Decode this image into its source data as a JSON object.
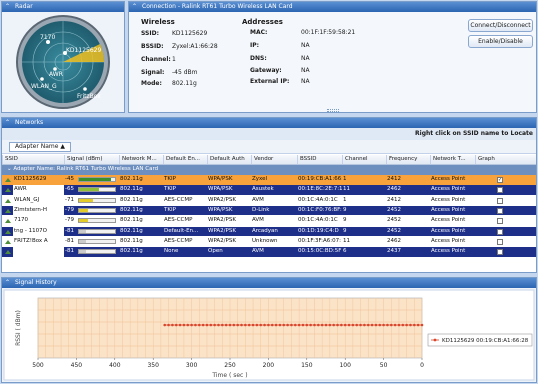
{
  "radar": {
    "title": "Radar",
    "labels": [
      "7170",
      "KD1125629",
      "AWR",
      "WLAN_G",
      "FritzBox"
    ]
  },
  "connection": {
    "title": "Connection - Ralink RT61 Turbo Wireless LAN Card",
    "wireless": {
      "heading": "Wireless",
      "ssid_label": "SSID:",
      "ssid": "KD1125629",
      "bssid_label": "BSSID:",
      "bssid": "Zyxel:A1:66:28",
      "channel_label": "Channel:",
      "channel": "1",
      "signal_label": "Signal:",
      "signal": "-45 dBm",
      "mode_label": "Mode:",
      "mode": "802.11g"
    },
    "addresses": {
      "heading": "Addresses",
      "mac_label": "MAC:",
      "mac": "00:1F:1F:59:58:21",
      "ip_label": "IP:",
      "ip": "NA",
      "dns_label": "DNS:",
      "dns": "NA",
      "gateway_label": "Gateway:",
      "gateway": "NA",
      "external_ip_label": "External IP:",
      "external_ip": "NA"
    },
    "buttons": {
      "connect": "Connect/Disconnect",
      "enable": "Enable/Disable"
    }
  },
  "networks": {
    "title": "Networks",
    "hint": "Right click on SSID name to Locate",
    "group_chip": "Adapter Name ▲",
    "group_row": "Adapter Name: Ralink RT61 Turbo Wireless LAN Card",
    "columns": [
      "SSID",
      "Signal (dBm)",
      "Network M...",
      "Default En...",
      "Default Auth",
      "Vendor",
      "BSSID",
      "Channel",
      "Frequency",
      "Network T...",
      "Graph"
    ],
    "rows": [
      {
        "ssid": "KD1125629",
        "signal": "-45",
        "mode": "802.11g",
        "enc": "TKIP",
        "auth": "WPA/PSK",
        "vendor": "Zyxel",
        "bssid": "00:19:CB:A1:66:28",
        "channel": "1",
        "freq": "2412",
        "type": "Access Point",
        "graph": "✓",
        "level": 0.88,
        "bar": "#3a8f2a",
        "style": "selected"
      },
      {
        "ssid": "AWR",
        "signal": "-65",
        "mode": "802.11g",
        "enc": "TKIP",
        "auth": "WPA/PSK",
        "vendor": "Asustek",
        "bssid": "00:1E:8C:2E:7:11",
        "channel": "11",
        "freq": "2462",
        "type": "Access Point",
        "graph": "",
        "level": 0.55,
        "bar": "#8fbf3a",
        "style": "dark"
      },
      {
        "ssid": "WLAN_GJ",
        "signal": "-71",
        "mode": "802.11g",
        "enc": "AES-CCMP",
        "auth": "WPA2/PSK",
        "vendor": "AVM",
        "bssid": "00:1C:4A:0:1C",
        "channel": "1",
        "freq": "2412",
        "type": "Access Point",
        "graph": "",
        "level": 0.4,
        "bar": "#e3cc2a",
        "style": "light"
      },
      {
        "ssid": "Zimtstern-H",
        "signal": "-79",
        "mode": "802.11g",
        "enc": "TKIP",
        "auth": "WPA/PSK",
        "vendor": "D-Link",
        "bssid": "00:1C:F0:76:BF:",
        "channel": "9",
        "freq": "2452",
        "type": "Access Point",
        "graph": "",
        "level": 0.25,
        "bar": "#e3cc2a",
        "style": "dark"
      },
      {
        "ssid": "7170",
        "signal": "-79",
        "mode": "802.11g",
        "enc": "AES-CCMP",
        "auth": "WPA2/PSK",
        "vendor": "AVM",
        "bssid": "00:1C:4A:0:1C",
        "channel": "9",
        "freq": "2452",
        "type": "Access Point",
        "graph": "",
        "level": 0.25,
        "bar": "#e3cc2a",
        "style": "light"
      },
      {
        "ssid": "tng - 1107O",
        "signal": "-81",
        "mode": "802.11g",
        "enc": "Default-En...",
        "auth": "WPA2/PSK",
        "vendor": "Arcadyan",
        "bssid": "00:1D:19:C4:D",
        "channel": "9",
        "freq": "2452",
        "type": "Access Point",
        "graph": "",
        "level": 0.2,
        "bar": "#cccccc",
        "style": "dark"
      },
      {
        "ssid": "FRITZ!Box A",
        "signal": "-81",
        "mode": "802.11g",
        "enc": "AES-CCMP",
        "auth": "WPA2/PSK",
        "vendor": "Unknown",
        "bssid": "00:1F:3F:A6:07:",
        "channel": "11",
        "freq": "2462",
        "type": "Access Point",
        "graph": "",
        "level": 0.2,
        "bar": "#cccccc",
        "style": "light"
      },
      {
        "ssid": "",
        "signal": "-81",
        "mode": "802.11g",
        "enc": "None",
        "auth": "Open",
        "vendor": "AVM",
        "bssid": "00:15:0C:BD:5F",
        "channel": "6",
        "freq": "2437",
        "type": "Access Point",
        "graph": "",
        "level": 0.2,
        "bar": "#cccccc",
        "style": "dark"
      }
    ]
  },
  "history": {
    "title": "Signal History",
    "legend": "KD1125629 00:19:CB:A1:66:28",
    "series_color": "#d9452b"
  },
  "chart_data": {
    "type": "line",
    "xlabel": "Time ( sec )",
    "ylabel": "RSSI ( dBm)",
    "xlim": [
      500,
      0
    ],
    "xticks": [
      500,
      450,
      400,
      350,
      300,
      250,
      200,
      150,
      100,
      50,
      0
    ],
    "ylim": [
      -100,
      0
    ],
    "yticks": [
      -20,
      -40,
      -60,
      -80
    ],
    "grid": true,
    "legend_position": "right",
    "series": [
      {
        "name": "KD1125629 00:19:CB:A1:66:28",
        "x_start": 335,
        "x_end": 0,
        "x_step": 5,
        "value": -45
      }
    ]
  }
}
